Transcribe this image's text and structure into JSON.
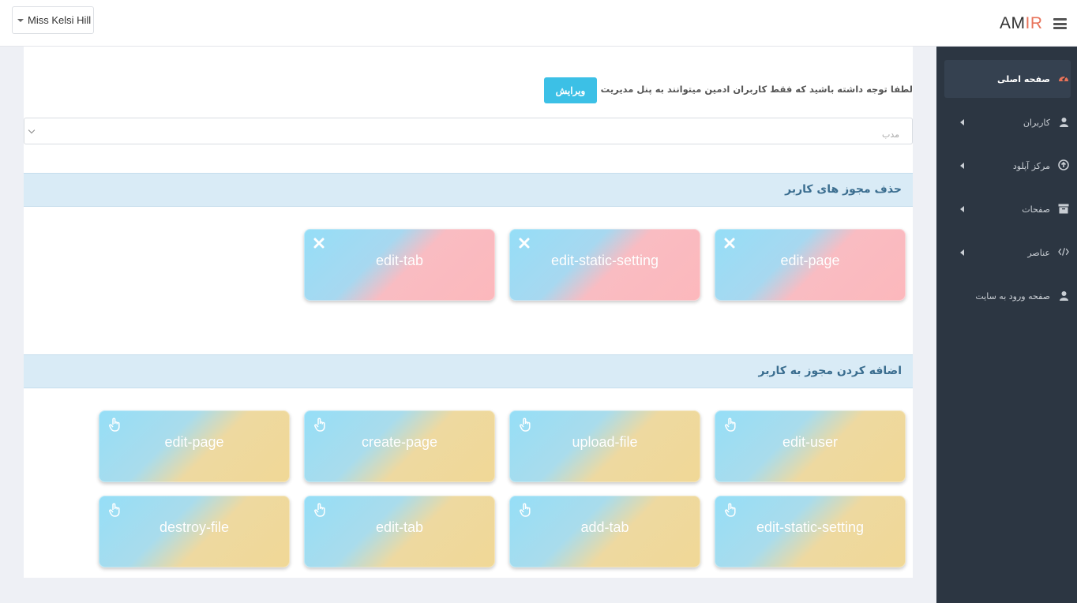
{
  "header": {
    "user_name": "Miss Kelsi Hill",
    "logo_part1": "AM",
    "logo_part2": "IR"
  },
  "sidebar": {
    "items": [
      {
        "label": "صفحه اصلی",
        "icon": "dashboard-icon",
        "active": true
      },
      {
        "label": "کاربران",
        "icon": "user-icon",
        "has_submenu": true
      },
      {
        "label": "مرکز آپلود",
        "icon": "upload-icon",
        "has_submenu": true
      },
      {
        "label": "صفحات",
        "icon": "archive-icon",
        "has_submenu": true
      },
      {
        "label": "عناصر",
        "icon": "code-icon",
        "has_submenu": true
      },
      {
        "label": "صفحه ورود به سایت",
        "icon": "user-icon"
      }
    ]
  },
  "main": {
    "notice": "لطفا توجه داشته باشید که فقط کاربران ادمین میتوانند به پنل مدیریت وارد شوند.",
    "edit_button": "ویرایش",
    "select_value": "مدب",
    "delete_section_title": "حذف مجوز های کاربر",
    "add_section_title": "اضافه کردن مجوز به کاربر",
    "delete_permissions": [
      "edit-page",
      "edit-static-setting",
      "edit-tab"
    ],
    "add_permissions": [
      "edit-user",
      "upload-file",
      "create-page",
      "edit-page",
      "edit-static-setting",
      "add-tab",
      "edit-tab",
      "destroy-file"
    ]
  },
  "colors": {
    "sidebar_bg": "#2c3642",
    "accent_button": "#3cc0e6",
    "section_header_bg": "#d9ebf6",
    "logo_accent": "#e8735a"
  }
}
